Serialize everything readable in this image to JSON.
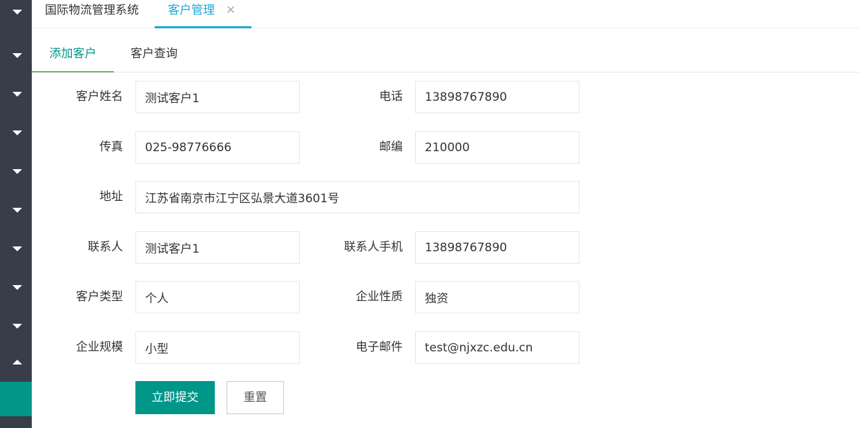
{
  "header": {
    "home_tab": "国际物流管理系统",
    "active_tab": "客户管理",
    "close_glyph": "✕"
  },
  "subtabs": [
    {
      "label": "添加客户",
      "active": true
    },
    {
      "label": "客户查询",
      "active": false
    }
  ],
  "form": {
    "name": {
      "label": "客户姓名",
      "value": "测试客户1"
    },
    "phone": {
      "label": "电话",
      "value": "13898767890"
    },
    "fax": {
      "label": "传真",
      "value": "025-98776666"
    },
    "postcode": {
      "label": "邮编",
      "value": "210000"
    },
    "address": {
      "label": "地址",
      "value": "江苏省南京市江宁区弘景大道3601号"
    },
    "contact": {
      "label": "联系人",
      "value": "测试客户1"
    },
    "contact_mobile": {
      "label": "联系人手机",
      "value": "13898767890"
    },
    "customer_type": {
      "label": "客户类型",
      "value": "个人"
    },
    "enterprise_nature": {
      "label": "企业性质",
      "value": "独资"
    },
    "enterprise_scale": {
      "label": "企业规模",
      "value": "小型"
    },
    "email": {
      "label": "电子邮件",
      "value": "test@njxzc.edu.cn"
    }
  },
  "buttons": {
    "submit": "立即提交",
    "reset": "重置"
  },
  "sidebar": {
    "items": [
      {
        "icon": "chevron-down-icon"
      },
      {
        "icon": "chevron-down-icon"
      },
      {
        "icon": "chevron-down-icon"
      },
      {
        "icon": "chevron-down-icon"
      },
      {
        "icon": "chevron-down-icon"
      },
      {
        "icon": "chevron-down-icon"
      },
      {
        "icon": "chevron-down-icon"
      },
      {
        "icon": "chevron-down-icon"
      },
      {
        "icon": "chevron-down-icon"
      },
      {
        "icon": "chevron-up-icon"
      }
    ]
  },
  "colors": {
    "sidebar_bg": "#393d49",
    "accent_teal": "#009688",
    "tab_blue": "#1ea5d8",
    "subtab_underline": "#5fb878"
  }
}
